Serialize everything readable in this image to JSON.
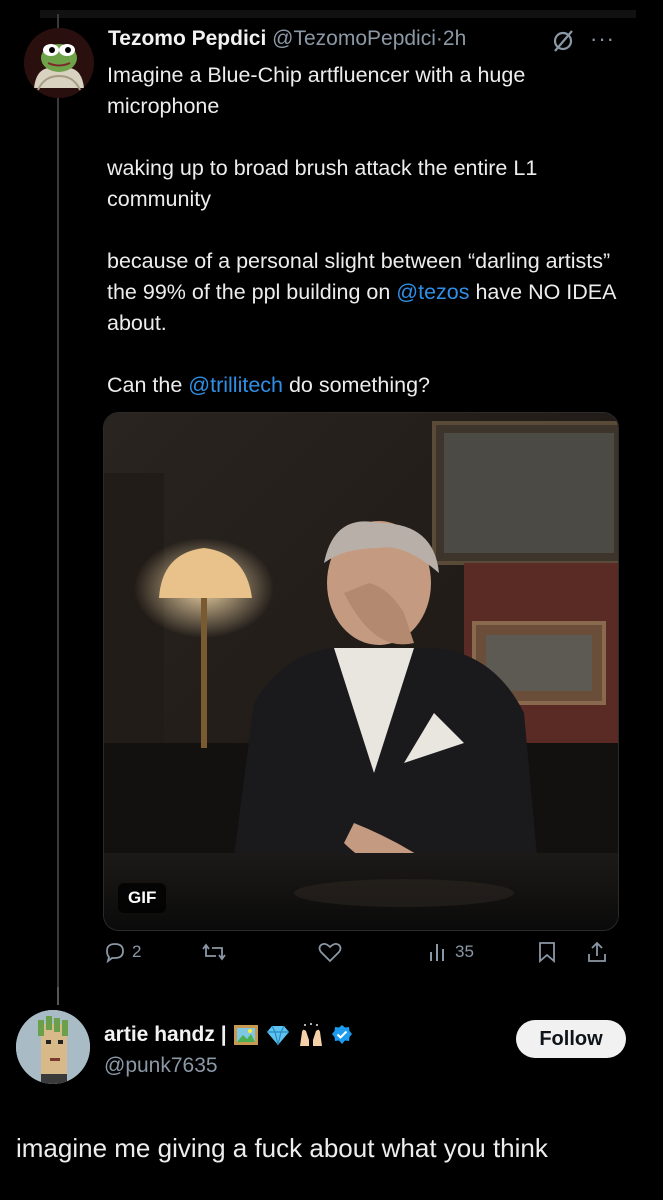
{
  "post1": {
    "author_name": "Tezomo Pepdici",
    "handle": "@TezomoPepdici",
    "separator": "·",
    "time": "2h",
    "more_label": "···",
    "para1": "Imagine a Blue-Chip artfluencer with a huge microphone",
    "para2": "waking up to broad brush attack the entire L1 community",
    "para3_a": "because of a personal slight between “darling artists” the 99% of the ppl building on ",
    "para3_mention": "@tezos",
    "para3_b": " have NO IDEA about.",
    "para4_a": "Can the ",
    "para4_mention": "@trillitech",
    "para4_b": " do something?",
    "media_badge": "GIF",
    "stats": {
      "replies": "2",
      "views": "35"
    }
  },
  "post2": {
    "author_name": "artie handz |",
    "handle": "@punk7635",
    "follow_label": "Follow",
    "body": "imagine me giving a fuck about what you think"
  },
  "colors": {
    "background": "#000000",
    "link": "#2f8fe6",
    "muted": "#8b98a5",
    "verified": "#1d9bf0"
  },
  "icons": [
    "no-slash-icon",
    "more-icon",
    "reply-icon",
    "retweet-icon",
    "like-icon",
    "views-icon",
    "bookmark-icon",
    "share-icon",
    "verified-badge-icon",
    "framed-picture-emoji",
    "gem-emoji",
    "raised-hands-emoji"
  ]
}
